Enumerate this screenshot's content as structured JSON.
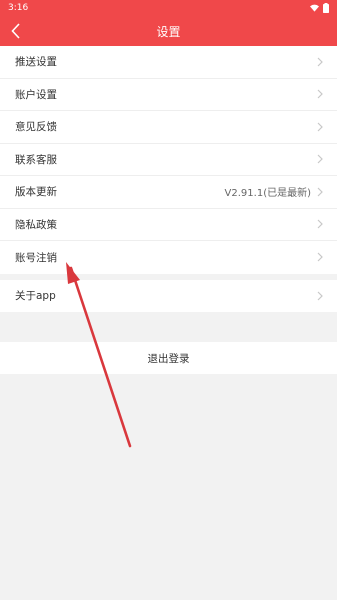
{
  "status_bar": {
    "time": "3:16",
    "icons": [
      "wifi-icon",
      "battery-icon"
    ]
  },
  "nav": {
    "title": "设置",
    "back_icon": "back-arrow-icon"
  },
  "settings_group_1": [
    {
      "label": "推送设置",
      "value": ""
    },
    {
      "label": "账户设置",
      "value": ""
    },
    {
      "label": "意见反馈",
      "value": ""
    },
    {
      "label": "联系客服",
      "value": ""
    },
    {
      "label": "版本更新",
      "value": "V2.91.1(已是最新)"
    },
    {
      "label": "隐私政策",
      "value": ""
    },
    {
      "label": "账号注销",
      "value": ""
    }
  ],
  "settings_group_2": [
    {
      "label": "关于app",
      "value": ""
    }
  ],
  "logout": {
    "label": "退出登录"
  },
  "colors": {
    "primary": "#f0484a",
    "annotation_arrow": "#d9383d"
  }
}
